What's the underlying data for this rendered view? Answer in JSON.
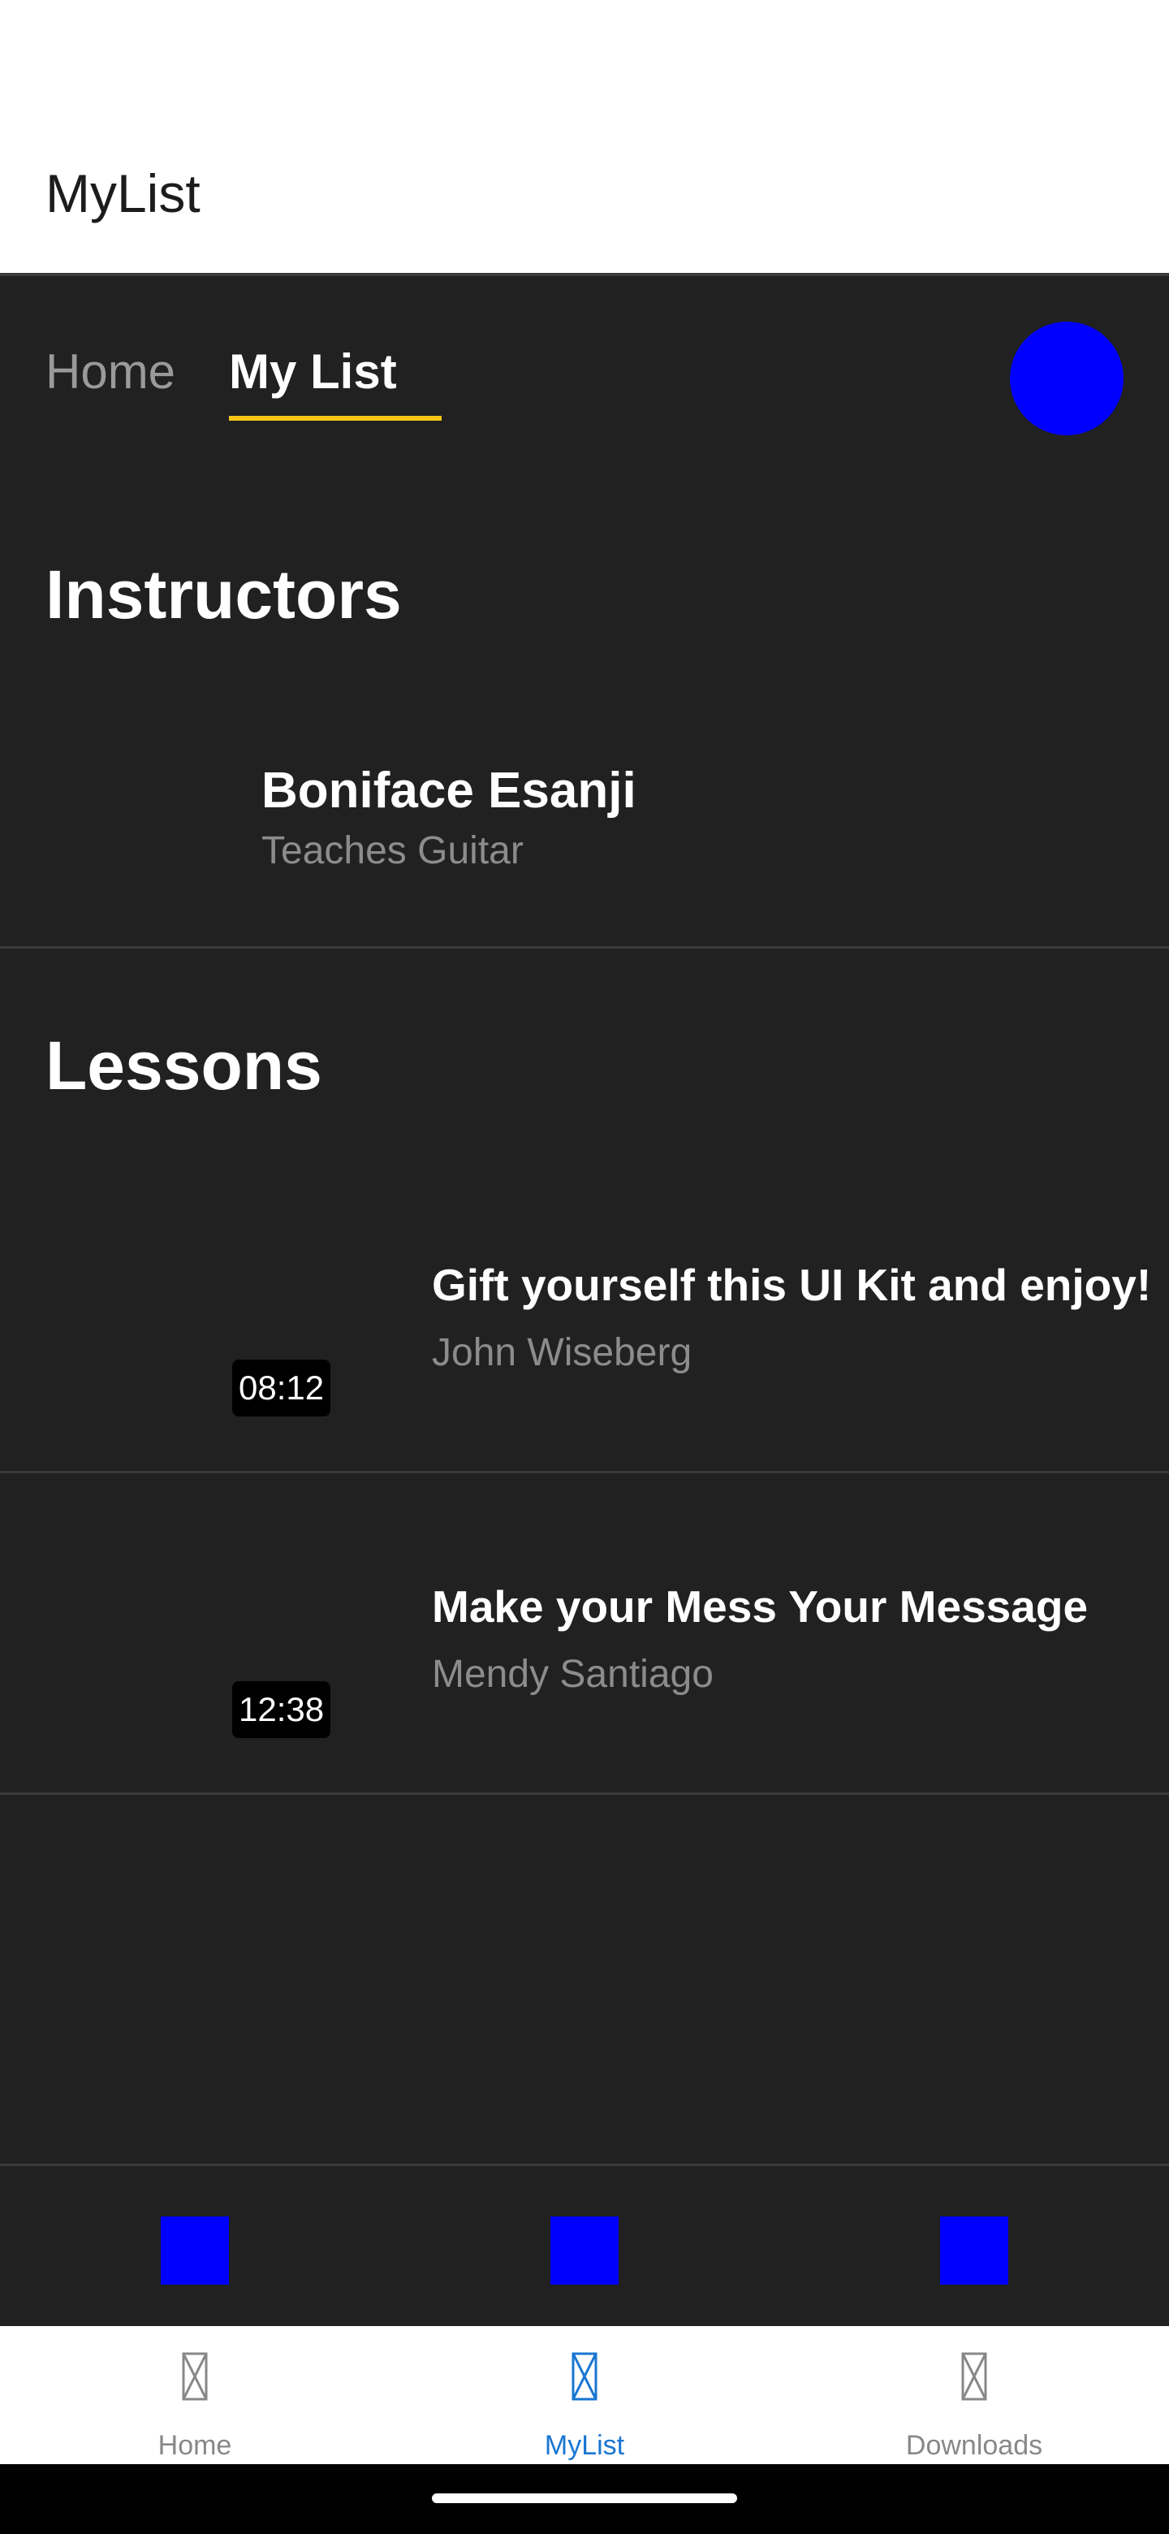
{
  "appbar": {
    "title": "MyList"
  },
  "tabs": {
    "items": [
      {
        "label": "Home"
      },
      {
        "label": "My List"
      }
    ],
    "active_color": "#f5c518"
  },
  "avatar": {
    "color": "#0000ff"
  },
  "instructors": {
    "title": "Instructors",
    "items": [
      {
        "name": "Boniface Esanji",
        "subtitle": "Teaches Guitar"
      }
    ]
  },
  "lessons": {
    "title": "Lessons",
    "items": [
      {
        "title": "Gift yourself this UI Kit and enjoy!",
        "author": "John Wiseberg",
        "duration": "08:12"
      },
      {
        "title": "Make your Mess Your Message",
        "author": "Mendy Santiago",
        "duration": "12:38"
      }
    ]
  },
  "toolbar": {
    "buttons": [
      {
        "icon": "square-icon",
        "color": "#0000ff"
      },
      {
        "icon": "square-icon",
        "color": "#0000ff"
      },
      {
        "icon": "square-icon",
        "color": "#0000ff"
      }
    ]
  },
  "bottom_nav": {
    "items": [
      {
        "label": "Home",
        "icon": "missing-glyph-icon"
      },
      {
        "label": "MyList",
        "icon": "missing-glyph-icon"
      },
      {
        "label": "Downloads",
        "icon": "missing-glyph-icon"
      }
    ],
    "active_color": "#1976d2",
    "inactive_color": "#888888"
  }
}
